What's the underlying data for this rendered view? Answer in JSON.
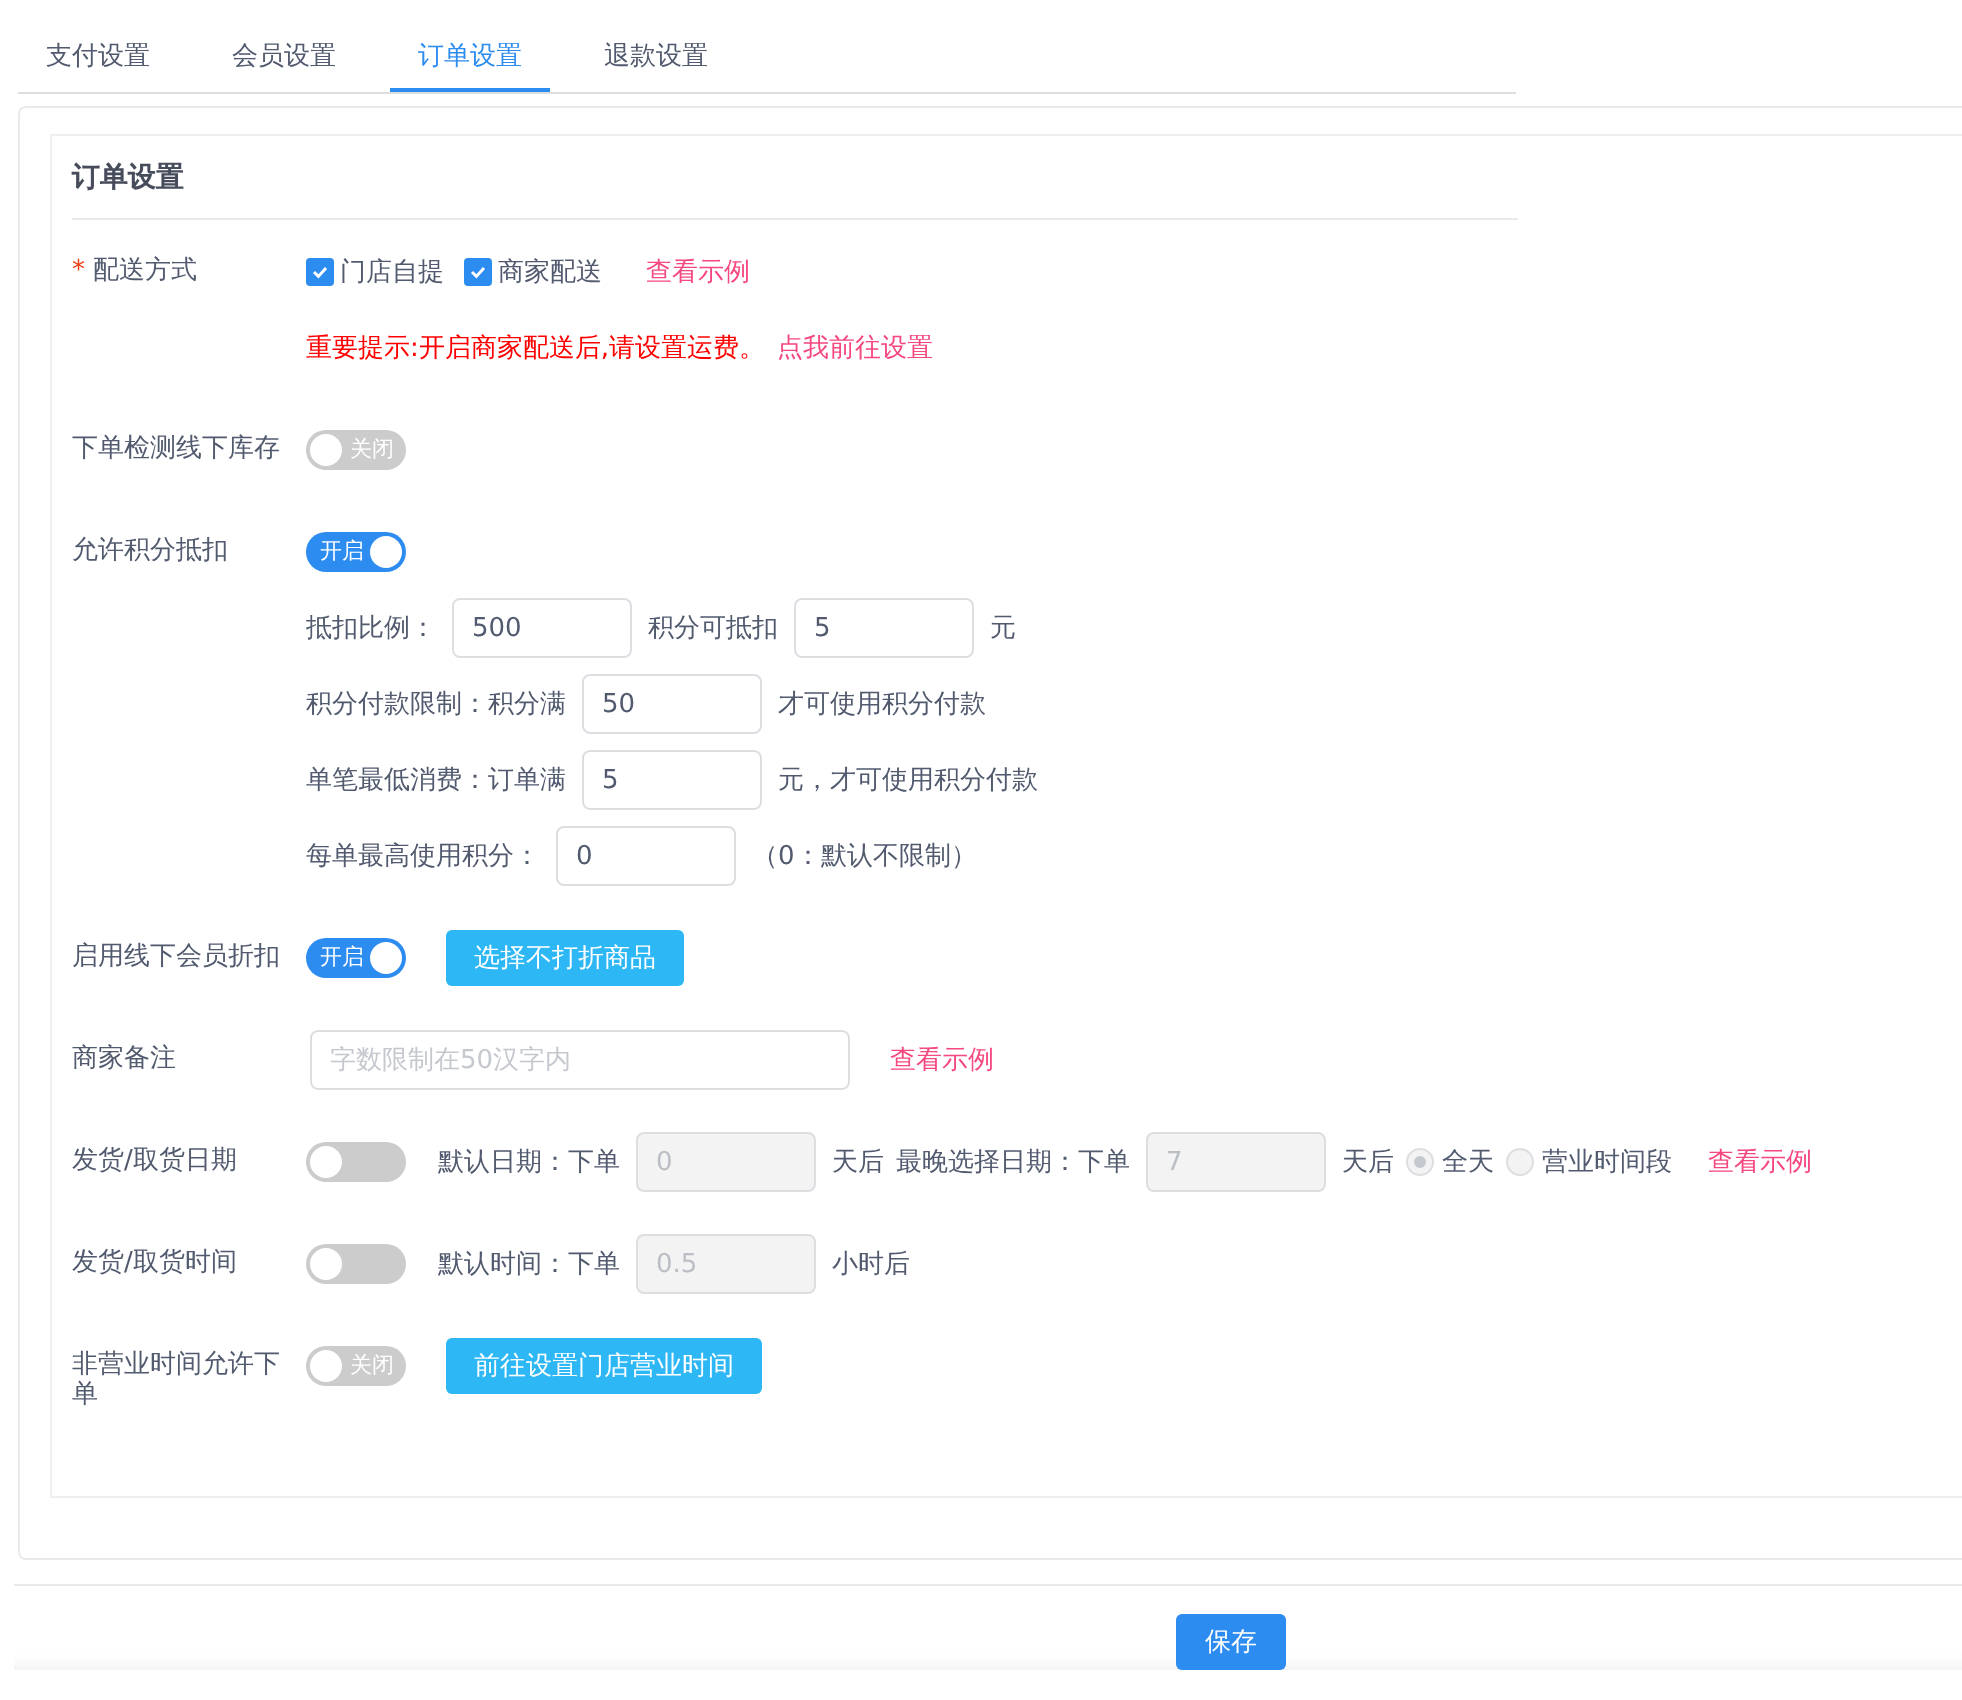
{
  "tabs": [
    {
      "label": "支付设置",
      "selected": false
    },
    {
      "label": "会员设置",
      "selected": false
    },
    {
      "label": "订单设置",
      "selected": true
    },
    {
      "label": "退款设置",
      "selected": false
    }
  ],
  "panel": {
    "title": "订单设置"
  },
  "rows": [
    {
      "label": "配送方式",
      "required_mark": "*",
      "parts": [
        {
          "kind": "checkbox",
          "label": "门店自提",
          "checked": true
        },
        {
          "kind": "checkbox",
          "label": "商家配送",
          "checked": true
        },
        {
          "kind": "link",
          "text": "查看示例"
        }
      ],
      "lines": [
        [
          {
            "kind": "warning",
            "text": "重要提示:开启商家配送后,请设置运费。"
          },
          {
            "kind": "link",
            "text": "点我前往设置"
          }
        ]
      ]
    },
    {
      "label": "下单检测线下库存",
      "parts": [
        {
          "kind": "switch",
          "on": false,
          "text": "关闭"
        }
      ]
    },
    {
      "label": "允许积分抵扣",
      "parts": [
        {
          "kind": "switch",
          "on": true,
          "text": "开启"
        }
      ],
      "lines": [
        [
          {
            "kind": "text",
            "text": "抵扣比例："
          },
          {
            "kind": "input",
            "value": "500",
            "disabled": false
          },
          {
            "kind": "text",
            "text": "积分可抵扣"
          },
          {
            "kind": "input",
            "value": "5",
            "disabled": false
          },
          {
            "kind": "text",
            "text": "元"
          }
        ],
        [
          {
            "kind": "text",
            "text": "积分付款限制：积分满"
          },
          {
            "kind": "input",
            "value": "50",
            "disabled": false
          },
          {
            "kind": "text",
            "text": "才可使用积分付款"
          }
        ],
        [
          {
            "kind": "text",
            "text": "单笔最低消费：订单满"
          },
          {
            "kind": "input",
            "value": "5",
            "disabled": false
          },
          {
            "kind": "text",
            "text": "元，才可使用积分付款"
          }
        ],
        [
          {
            "kind": "text",
            "text": "每单最高使用积分："
          },
          {
            "kind": "input",
            "value": "0",
            "disabled": false
          },
          {
            "kind": "text",
            "text": "（0：默认不限制）"
          }
        ]
      ]
    },
    {
      "label": "启用线下会员折扣",
      "parts": [
        {
          "kind": "switch",
          "on": true,
          "text": "开启"
        },
        {
          "kind": "button",
          "text": "选择不打折商品"
        }
      ]
    },
    {
      "label": "商家备注",
      "parts": [
        {
          "kind": "input",
          "placeholder": "字数限制在50汉字内",
          "disabled": false
        },
        {
          "kind": "link",
          "text": "查看示例"
        }
      ]
    },
    {
      "label": "发货/取货日期",
      "parts": [
        {
          "kind": "switch",
          "on": false
        },
        {
          "kind": "text",
          "text": "默认日期：下单"
        },
        {
          "kind": "input",
          "value": "0",
          "disabled": true
        },
        {
          "kind": "text",
          "text": "天后"
        },
        {
          "kind": "text",
          "text": "最晚选择日期：下单"
        },
        {
          "kind": "input",
          "value": "7",
          "disabled": true
        },
        {
          "kind": "text",
          "text": "天后"
        },
        {
          "kind": "radio",
          "label": "全天",
          "selected": true
        },
        {
          "kind": "radio",
          "label": "营业时间段",
          "selected": false
        },
        {
          "kind": "link",
          "text": "查看示例"
        }
      ]
    },
    {
      "label": "发货/取货时间",
      "parts": [
        {
          "kind": "switch",
          "on": false
        },
        {
          "kind": "text",
          "text": "默认时间：下单"
        },
        {
          "kind": "input",
          "value": "0.5",
          "disabled": true
        },
        {
          "kind": "text",
          "text": "小时后"
        }
      ]
    },
    {
      "label": "非营业时间允许下单",
      "parts": [
        {
          "kind": "switch",
          "on": false,
          "text": "关闭"
        },
        {
          "kind": "button",
          "text": "前往设置门店营业时间"
        }
      ]
    }
  ],
  "save_button": "保存"
}
